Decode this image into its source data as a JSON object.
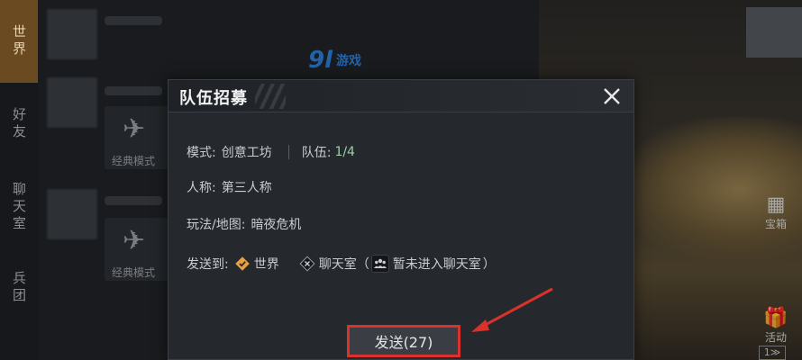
{
  "background": {
    "chat_tabs": [
      {
        "label": "世界",
        "active": true
      },
      {
        "label": "好友",
        "active": false
      },
      {
        "label": "聊天室",
        "active": false
      },
      {
        "label": "兵团",
        "active": false
      }
    ],
    "messages": [
      {
        "text": "经典模式"
      },
      {
        "text": "经典模式"
      }
    ],
    "watermark": {
      "logo": "9l",
      "text": "游戏"
    },
    "right_buttons": [
      {
        "label": "宝箱",
        "icon": "grid-icon"
      },
      {
        "label": "活动",
        "icon": "gift-icon"
      }
    ],
    "bottom_chip": "1≫"
  },
  "modal": {
    "title": "队伍招募",
    "mode_label": "模式:",
    "mode_value": "创意工坊",
    "team_label": "队伍:",
    "team_value": "1/4",
    "perspective_label": "人称:",
    "perspective_value": "第三人称",
    "map_label": "玩法/地图:",
    "map_value": "暗夜危机",
    "send_to_label": "发送到:",
    "channels": {
      "world": "世界",
      "chatroom": "聊天室（",
      "chatroom_status": "暂未进入聊天室",
      "close_paren": "）"
    },
    "send_button": "发送(27)"
  },
  "colors": {
    "accent_orange": "#e8a040",
    "highlight_red": "#d9322c",
    "team_green": "#9fd0a8"
  }
}
